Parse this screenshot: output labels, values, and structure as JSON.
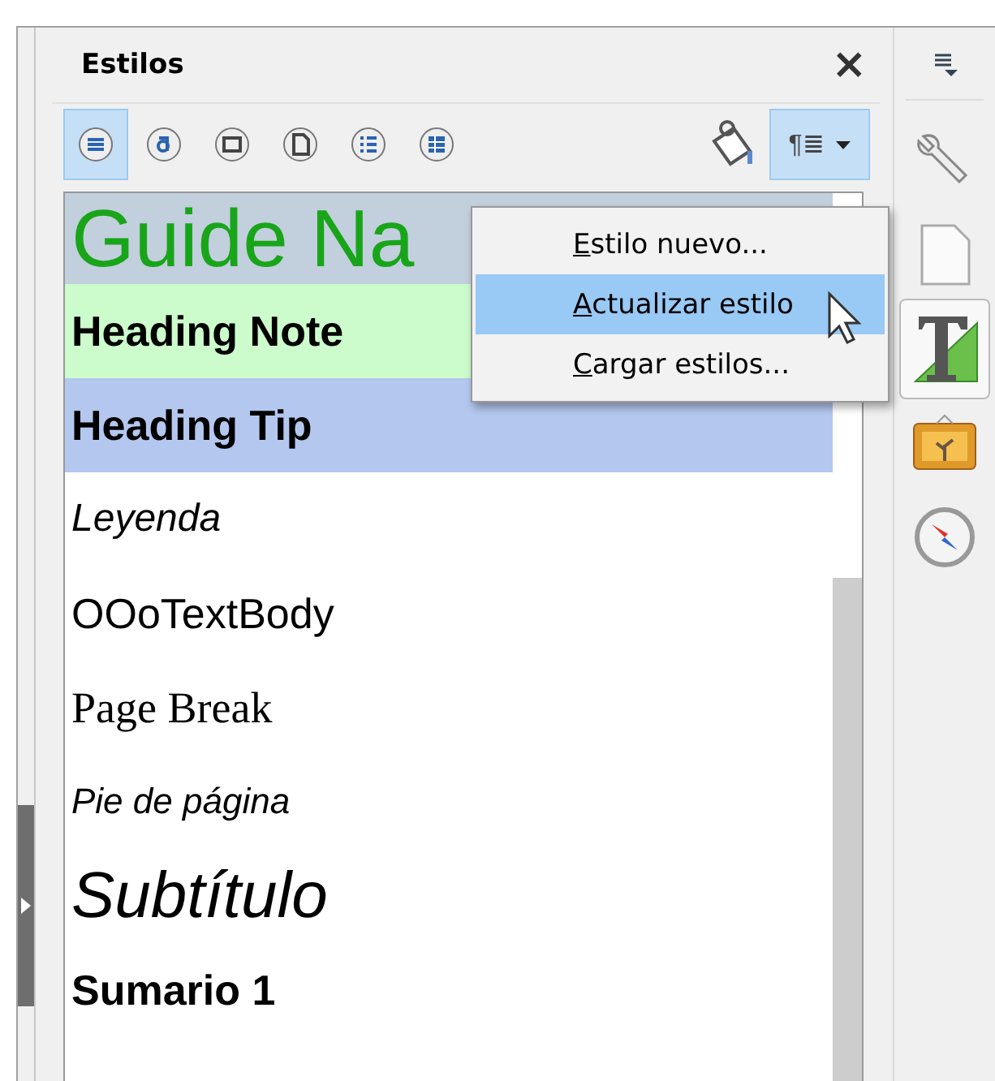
{
  "panel": {
    "title": "Estilos",
    "close": "×"
  },
  "categories": [
    {
      "selected": true
    },
    {
      "selected": false
    },
    {
      "selected": false
    },
    {
      "selected": false
    },
    {
      "selected": false
    },
    {
      "selected": false
    }
  ],
  "new_style_button": {
    "glyph": "¶≣",
    "pressed": true
  },
  "styles": [
    {
      "name": "Guide Na",
      "kind": "title",
      "color": "#c2cfdd"
    },
    {
      "name": "Heading Note",
      "kind": "bold",
      "color": "#ccfccc"
    },
    {
      "name": "Heading Tip",
      "kind": "bold",
      "color": "#b4c7ef"
    },
    {
      "name": "Leyenda",
      "kind": "italic"
    },
    {
      "name": "OOoTextBody",
      "kind": "body"
    },
    {
      "name": "Page Break",
      "kind": "serif"
    },
    {
      "name": "Pie de página",
      "kind": "small-italic"
    },
    {
      "name": "Subtítulo",
      "kind": "subtitle"
    },
    {
      "name": "Sumario 1",
      "kind": "bold"
    }
  ],
  "menu": [
    {
      "mnemonic": "E",
      "rest": "stilo nuevo...",
      "selected": false
    },
    {
      "mnemonic": "A",
      "rest": "ctualizar estilo",
      "selected": true
    },
    {
      "mnemonic": "C",
      "rest": "argar estilos...",
      "selected": false
    }
  ],
  "sidebar": [
    {
      "selected": false
    },
    {
      "selected": false
    },
    {
      "selected": true
    },
    {
      "selected": false
    },
    {
      "selected": false
    }
  ]
}
